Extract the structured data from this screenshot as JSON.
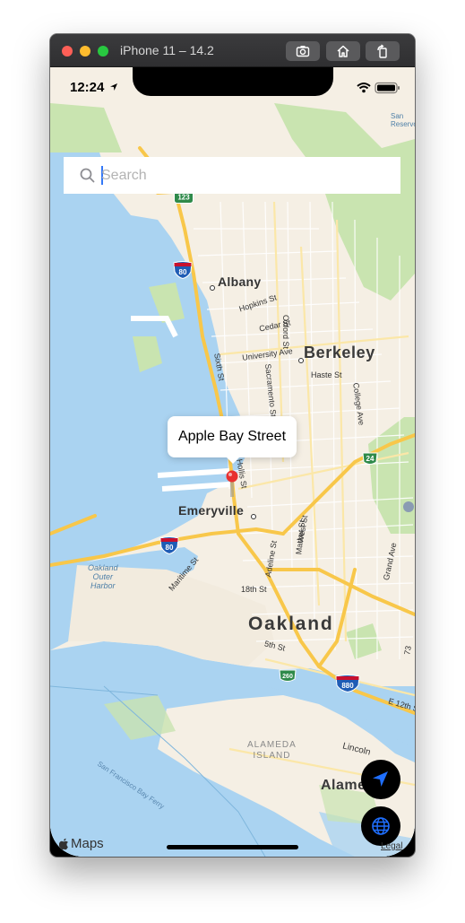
{
  "window": {
    "title": "iPhone 11 – 14.2"
  },
  "status_bar": {
    "time": "12:24"
  },
  "search": {
    "placeholder": "Search",
    "value": ""
  },
  "map": {
    "places": {
      "albany": "Albany",
      "berkeley": "Berkeley",
      "emeryville": "Emeryville",
      "oakland": "Oakland",
      "alameda_island": "ALAMEDA\nISLAND",
      "alameda": "Alame",
      "oakland_outer_harbor": "Oakland\nOuter\nHarbor",
      "san_reservoir": "San\nReservoir"
    },
    "streets": {
      "hopkins": "Hopkins St",
      "cedar": "Cedar St",
      "university": "University Ave",
      "haste": "Haste St",
      "oxford": "Oxford St",
      "sixth": "Sixth St",
      "sacramento": "Sacramento St",
      "college": "College Ave",
      "hollis": "Hollis St",
      "market": "Market St",
      "west": "West St",
      "adeline": "Adeline St",
      "maritime": "Maritime St",
      "eighteenth": "18th St",
      "fifth": "5th St",
      "grand": "Grand Ave",
      "lincoln": "Lincoln",
      "e12th": "E 12th S",
      "seventy3": "73",
      "sf_bay_ferry": "San Francisco Bay Ferry"
    },
    "shields": {
      "i80_north": "80",
      "i80_south": "80",
      "i880": "880",
      "sr123": "123",
      "sr24": "24",
      "sr260": "260"
    }
  },
  "callout": {
    "title": "Apple Bay Street"
  },
  "attribution": {
    "logo_text": "Maps",
    "legal": "Legal"
  },
  "colors": {
    "water": "#aad3f1",
    "land": "#f5efe4",
    "park": "#c9e4b0",
    "highway": "#f8c74a",
    "pin": "#e8312f",
    "accent_blue": "#3478f6"
  }
}
